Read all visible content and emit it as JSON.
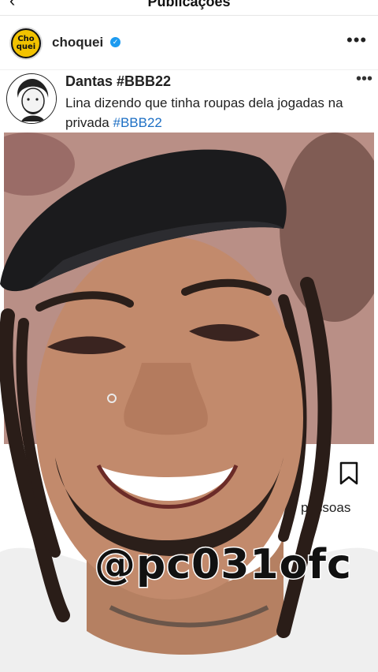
{
  "topbar": {
    "back_icon": "arrow-left-icon",
    "title": "Publicações"
  },
  "post": {
    "username": "choquei",
    "avatar_text": "Cho quei",
    "verified_icon": "verified-badge-icon",
    "more_icon": "more-horizontal-icon",
    "more_label": "•••"
  },
  "tweet": {
    "name": "Dantas #BBB22",
    "text_main": "Lina dizendo que tinha roupas dela jogadas na privada ",
    "hashtag": "#BBB22",
    "more_label": "•••"
  },
  "actions": {
    "bookmark_icon": "bookmark-icon",
    "likes_suffix": "pessoas"
  },
  "overlay": {
    "watermark": "@pc031ofc"
  },
  "colors": {
    "link": "#1d6fc4",
    "verified": "#1d9bf0",
    "brand_yellow": "#f2c200"
  }
}
